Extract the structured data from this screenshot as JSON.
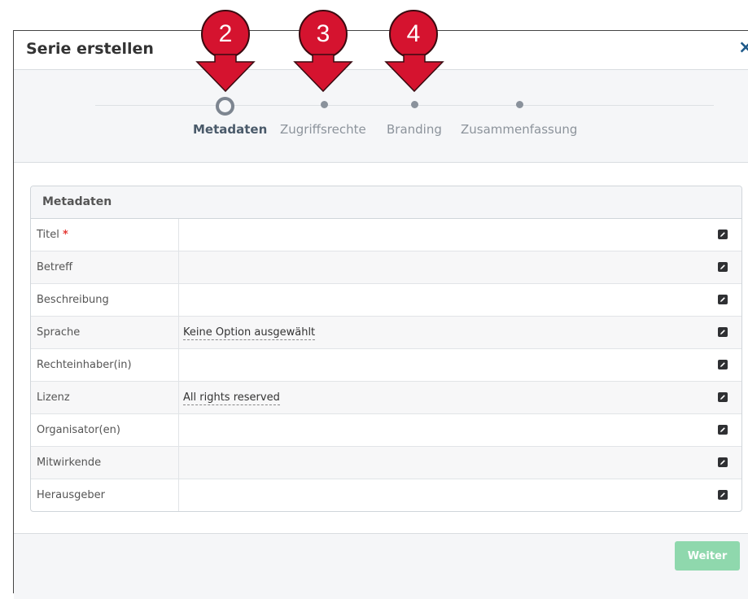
{
  "modal": {
    "title": "Serie erstellen",
    "close_glyph": "×"
  },
  "wizard": {
    "steps": [
      {
        "label": "Metadaten",
        "active": true
      },
      {
        "label": "Zugriffsrechte",
        "active": false
      },
      {
        "label": "Branding",
        "active": false
      },
      {
        "label": "Zusammenfassung",
        "active": false
      }
    ]
  },
  "callouts": [
    "2",
    "3",
    "4"
  ],
  "panel": {
    "title": "Metadaten",
    "required_mark": "*",
    "rows": [
      {
        "label": "Titel",
        "value": "",
        "required": true
      },
      {
        "label": "Betreff",
        "value": ""
      },
      {
        "label": "Beschreibung",
        "value": ""
      },
      {
        "label": "Sprache",
        "value": "Keine Option ausgewählt"
      },
      {
        "label": "Rechteinhaber(in)",
        "value": ""
      },
      {
        "label": "Lizenz",
        "value": "All rights reserved"
      },
      {
        "label": "Organisator(en)",
        "value": ""
      },
      {
        "label": "Mitwirkende",
        "value": ""
      },
      {
        "label": "Herausgeber",
        "value": ""
      }
    ]
  },
  "footer": {
    "next_label": "Weiter"
  },
  "colors": {
    "callout": "#d5132f",
    "accent_button": "#8fd8ad",
    "close": "#1e5a8a"
  },
  "icons": {
    "edit": "edit-icon",
    "close": "close-icon"
  }
}
